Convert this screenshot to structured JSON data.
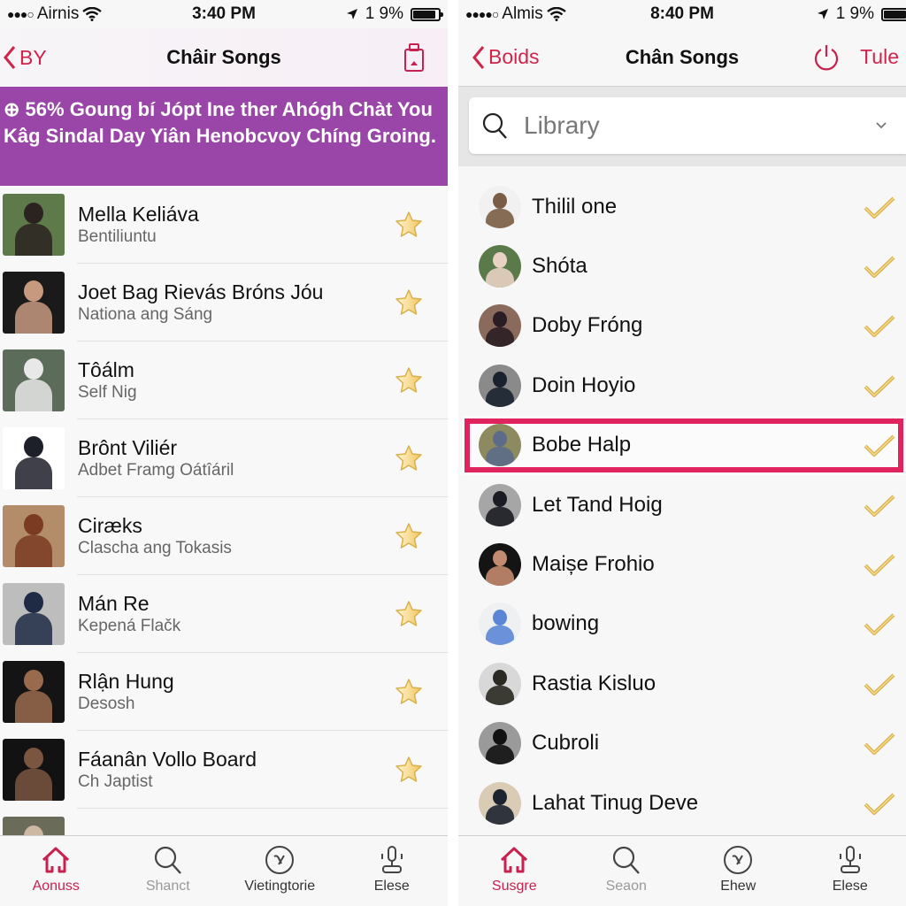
{
  "colors": {
    "accent": "#d0244b",
    "banner": "#9a45a8",
    "highlight": "#e0245e",
    "star": "#f0c65a",
    "check": "#d9b04a"
  },
  "left": {
    "status": {
      "carrier": "Airnis",
      "time": "3:40 PM",
      "battery": "1 9%",
      "battery_level": 0.9
    },
    "nav": {
      "back_label": "BY",
      "title": "Châir Songs",
      "right_icon": "battery-bag-icon"
    },
    "banner": {
      "icon": "info-circle-icon",
      "text": "56% Goung bí Jópt Ine ther Ahógh Chàt You Kâg Sindal Day Yiân Henobcvoy Chíng Groing."
    },
    "items": [
      {
        "name": "Mella Keliáva",
        "sub": "Bentiliuntu",
        "favorite": true
      },
      {
        "name": "Joet Bag Rievás Bróns Jóu",
        "sub": "Nationa ang Sáng",
        "favorite": true
      },
      {
        "name": "Tôálm",
        "sub": "Self Nig",
        "favorite": true
      },
      {
        "name": "Brônt Viliér",
        "sub": "Adbet Framg Oátîáril",
        "favorite": true
      },
      {
        "name": "Ciræks",
        "sub": "Clascha ang Tokasis",
        "favorite": true
      },
      {
        "name": "Mán Re",
        "sub": "Kepená Flačk",
        "favorite": true
      },
      {
        "name": "Rlận Hung",
        "sub": "Desosh",
        "favorite": true
      },
      {
        "name": "Fáanân Vollo Board",
        "sub": "Ch Japtist",
        "favorite": true
      },
      {
        "name": "",
        "sub": "",
        "favorite": false
      }
    ],
    "tabs": [
      {
        "label": "Aonuss",
        "icon": "home-icon",
        "state": "active"
      },
      {
        "label": "Shanct",
        "icon": "search-icon",
        "state": "dim"
      },
      {
        "label": "Vietingtorie",
        "icon": "circle-music-icon",
        "state": "normal"
      },
      {
        "label": "Elese",
        "icon": "microphone-stand-icon",
        "state": "normal"
      }
    ]
  },
  "right": {
    "status": {
      "carrier": "Almis",
      "time": "8:40 PM",
      "battery": "1 9%",
      "battery_level": 0.9
    },
    "nav": {
      "back_label": "Boids",
      "title": "Chân Songs",
      "action_label": "Tule",
      "action_icon": "power-icon"
    },
    "search": {
      "placeholder": "Library",
      "value": ""
    },
    "items": [
      {
        "name": "Thilil one",
        "checked": true,
        "selected": false
      },
      {
        "name": "Shóta",
        "checked": true,
        "selected": false
      },
      {
        "name": "Doby Fróng",
        "checked": true,
        "selected": false
      },
      {
        "name": "Doin Hoyio",
        "checked": true,
        "selected": false
      },
      {
        "name": "Bobe Halp",
        "checked": true,
        "selected": true
      },
      {
        "name": "Let Tand Hoig",
        "checked": true,
        "selected": false
      },
      {
        "name": "Maișe Frohio",
        "checked": true,
        "selected": false
      },
      {
        "name": "bowing",
        "checked": true,
        "selected": false
      },
      {
        "name": "Rastia Kisluo",
        "checked": true,
        "selected": false
      },
      {
        "name": "Cubroli",
        "checked": true,
        "selected": false
      },
      {
        "name": "Lahat Tinug Deve",
        "checked": true,
        "selected": false
      }
    ],
    "tabs": [
      {
        "label": "Susgre",
        "icon": "home-icon",
        "state": "active"
      },
      {
        "label": "Seaon",
        "icon": "search-icon",
        "state": "dim"
      },
      {
        "label": "Ehew",
        "icon": "circle-music-icon",
        "state": "normal"
      },
      {
        "label": "Elese",
        "icon": "microphone-stand-icon",
        "state": "normal"
      }
    ]
  }
}
